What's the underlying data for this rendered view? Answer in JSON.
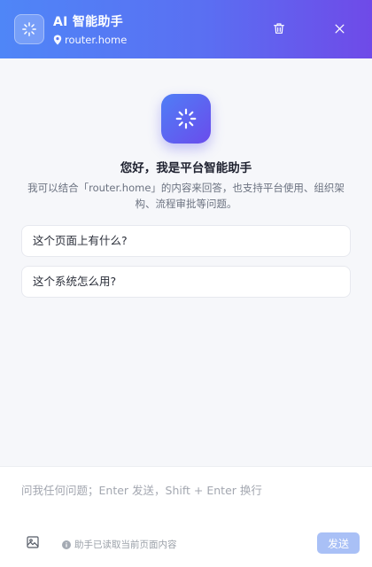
{
  "header": {
    "title": "AI 智能助手",
    "subtitle": "router.home",
    "colors": {
      "gradient_start": "#4f86f7",
      "gradient_end": "#6f4ae8"
    },
    "icons": [
      "sparkle-icon",
      "location-pin-icon",
      "trash-icon",
      "close-icon"
    ]
  },
  "welcome": {
    "greeting": "您好，我是平台智能助手",
    "description": "我可以结合「router.home」的内容来回答，也支持平台使用、组织架构、流程审批等问题。"
  },
  "suggestions": [
    {
      "label": "这个页面上有什么?"
    },
    {
      "label": "这个系统怎么用?"
    }
  ],
  "composer": {
    "placeholder": "问我任何问题；Enter 发送，Shift + Enter 换行",
    "value": "",
    "hint": "助手已读取当前页面内容",
    "send_label": "发送",
    "send_color": "#a9c0f6"
  }
}
